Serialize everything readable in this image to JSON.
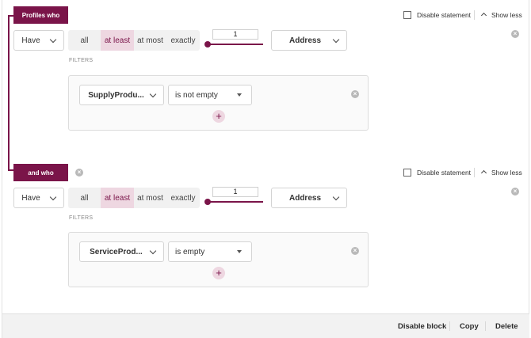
{
  "blocks": [
    {
      "tag": "Profiles who",
      "have": "Have",
      "quantifier_options": [
        "all",
        "at least",
        "at most",
        "exactly"
      ],
      "quantifier_active": "at least",
      "count": "1",
      "entity": "Address",
      "filters_label": "FILTERS",
      "filter": {
        "field": "SupplyProdu...",
        "operator": "is not empty"
      },
      "disable_statement": "Disable statement",
      "show_less": "Show less"
    },
    {
      "tag": "and who",
      "have": "Have",
      "quantifier_options": [
        "all",
        "at least",
        "at most",
        "exactly"
      ],
      "quantifier_active": "at least",
      "count": "1",
      "entity": "Address",
      "filters_label": "FILTERS",
      "filter": {
        "field": "ServiceProd...",
        "operator": "is empty"
      },
      "disable_statement": "Disable statement",
      "show_less": "Show less"
    }
  ],
  "footer": {
    "disable_block": "Disable block",
    "copy": "Copy",
    "delete": "Delete"
  },
  "colors": {
    "accent": "#7a1449",
    "accent_light": "#eed7e1"
  }
}
